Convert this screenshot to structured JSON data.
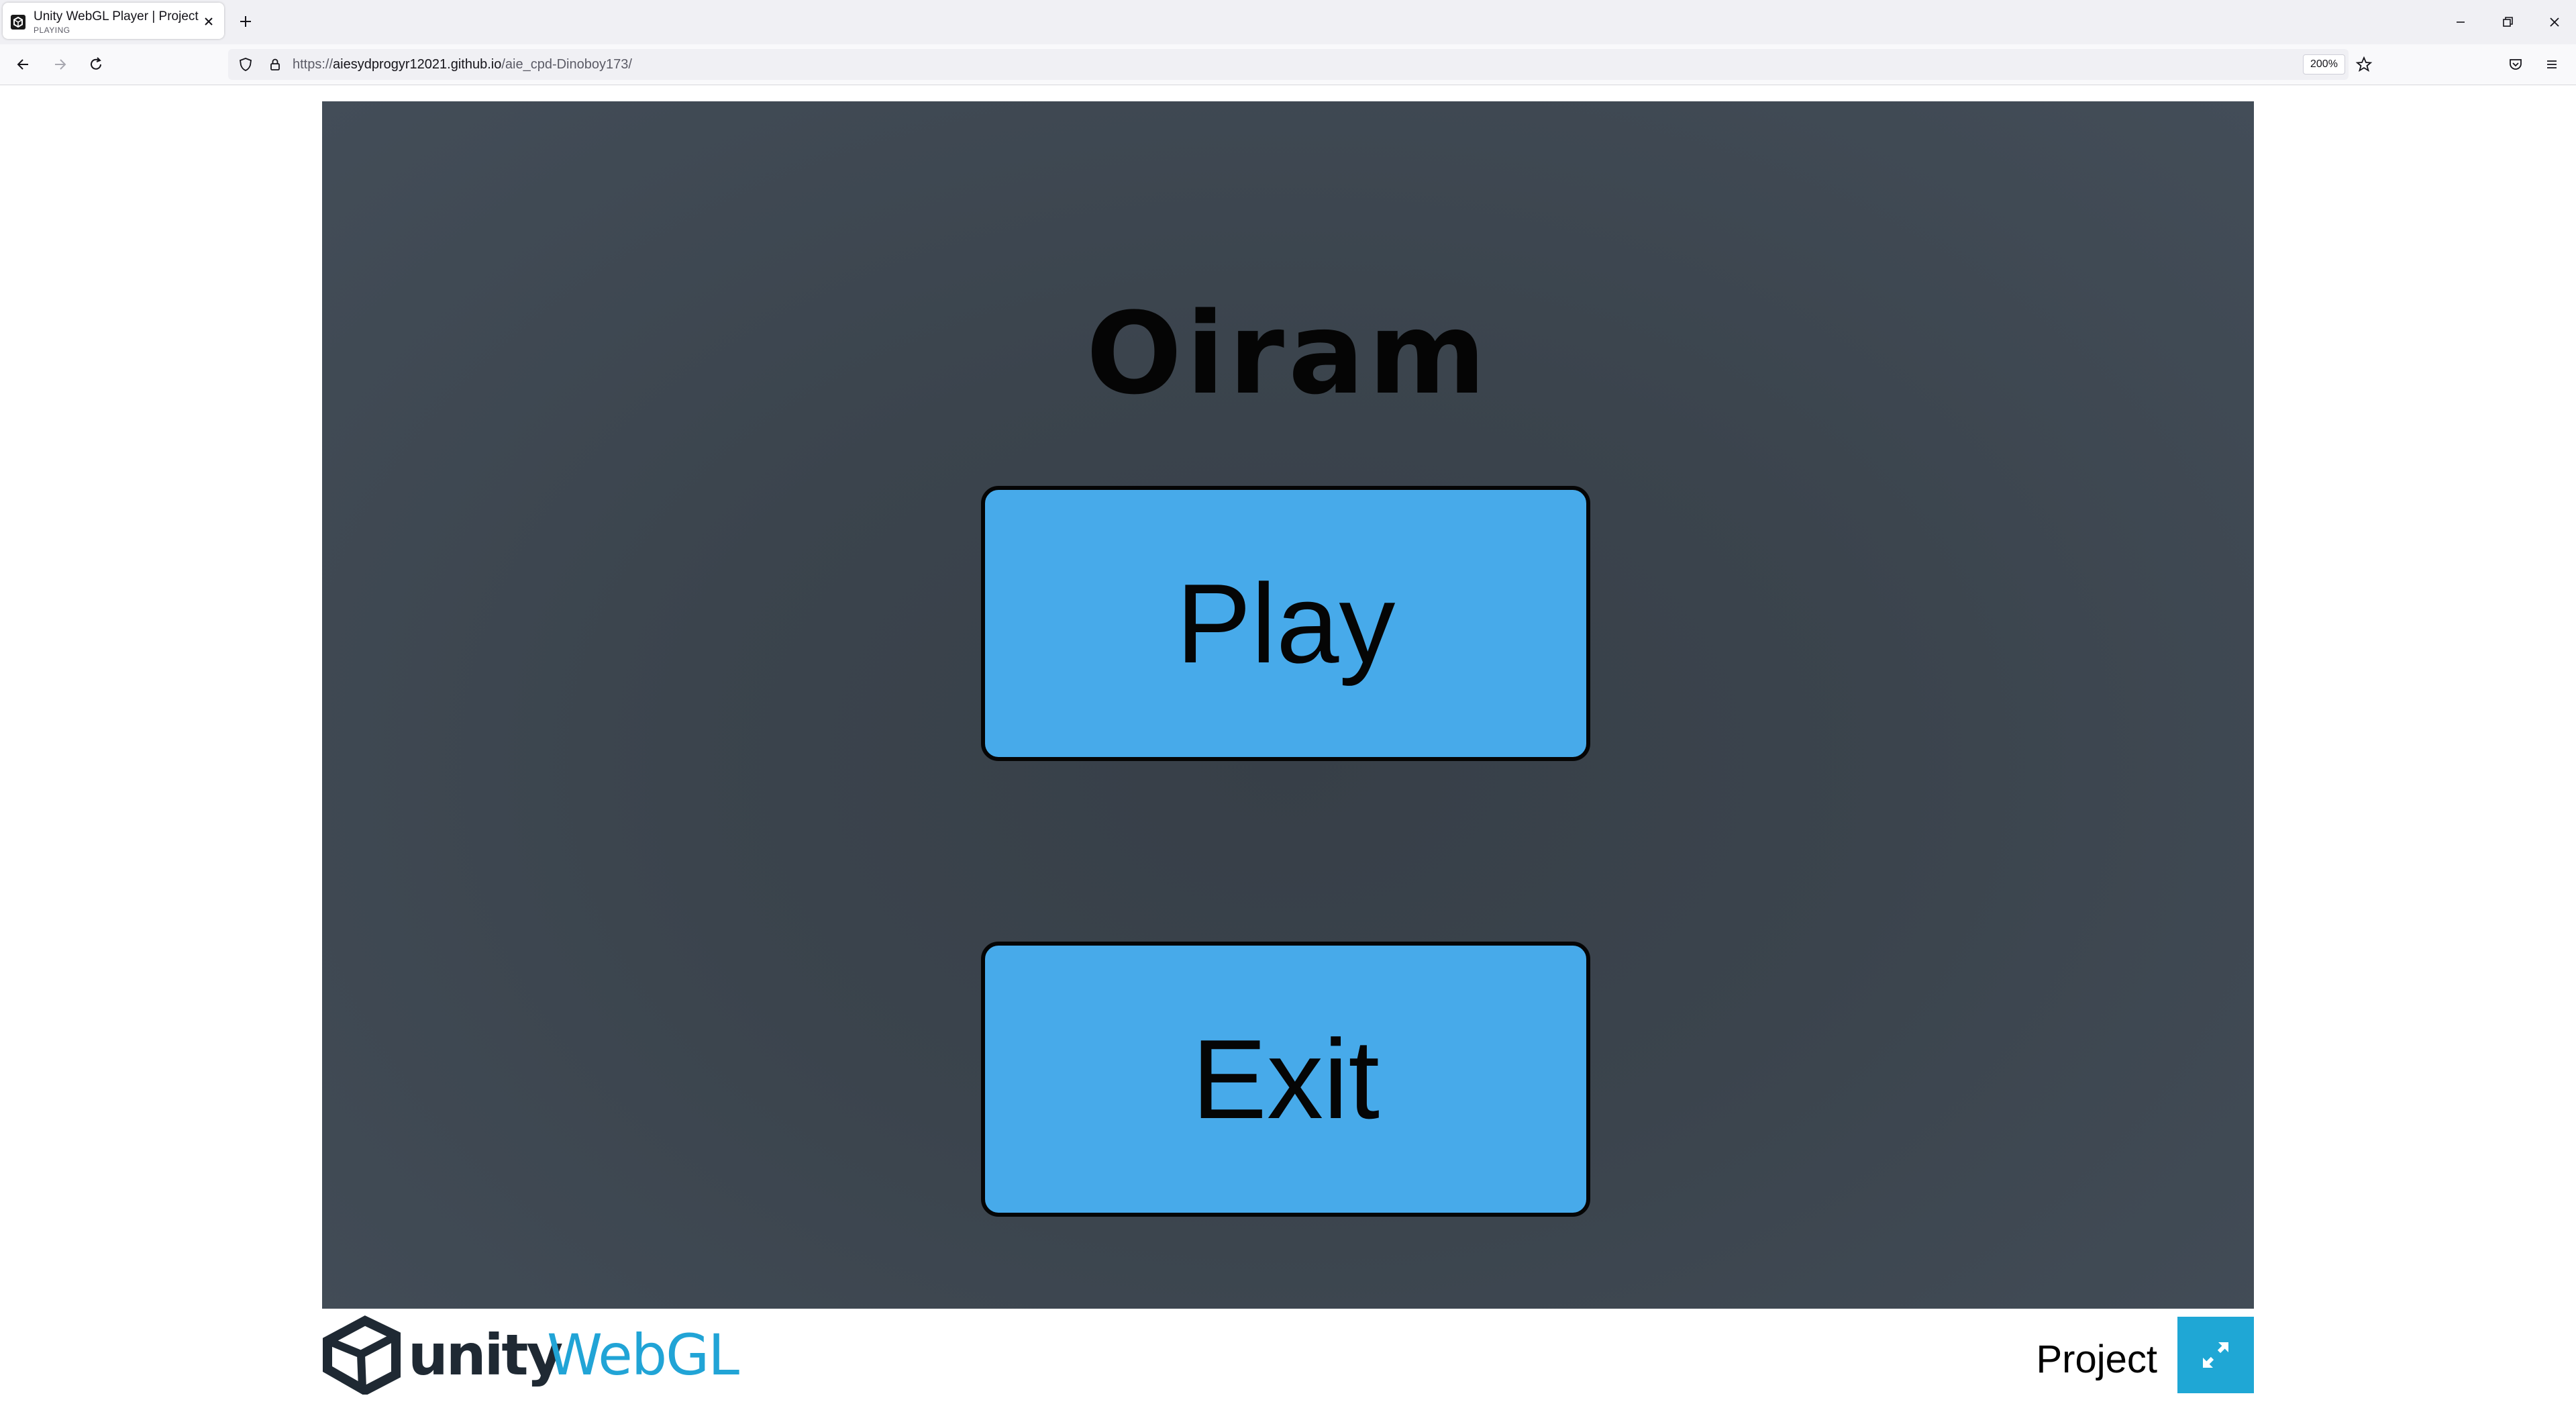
{
  "browser": {
    "tab": {
      "title": "Unity WebGL Player | Project",
      "subtitle": "PLAYING"
    },
    "url": {
      "scheme": "https://",
      "host": "aiesydprogyr12021.github.io",
      "path": "/aie_cpd-Dinoboy173/"
    },
    "zoom": "200%"
  },
  "game": {
    "title": "Oiram",
    "play_label": "Play",
    "exit_label": "Exit"
  },
  "footer": {
    "unity_text": "unity",
    "webgl_text": "WebGL",
    "project_title": "Project"
  },
  "colors": {
    "button_fill": "#47aaea",
    "canvas_bg": "#3b444d",
    "webgl_accent": "#21a4d6",
    "fullscreen_bg": "#1fa7d5"
  }
}
